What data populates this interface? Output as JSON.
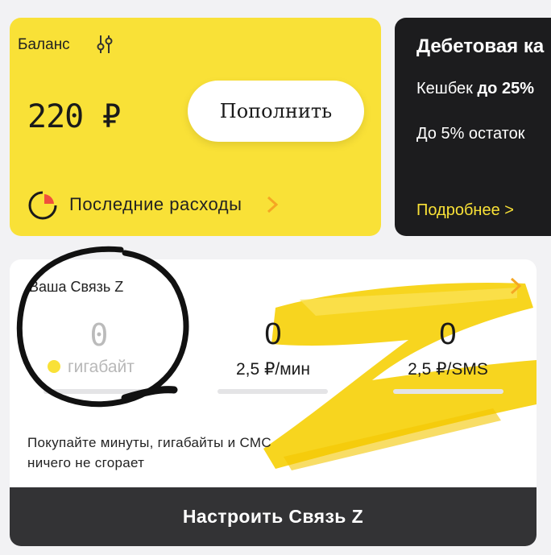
{
  "balance": {
    "title": "Баланс",
    "amount": "220 ₽",
    "topup_label": "Пополнить",
    "expenses_label": "Последние расходы"
  },
  "debit": {
    "title": "Дебетовая ка",
    "cashback_prefix": "Кешбек ",
    "cashback_bold": "до 25%",
    "balance_text": "До 5% остаток",
    "more_label": "Подробнее >"
  },
  "svyaz": {
    "title": "Ваша Связь Z",
    "stats": [
      {
        "value": "0",
        "unit": "гигабайт"
      },
      {
        "value": "0",
        "unit": "2,5 ₽/мин"
      },
      {
        "value": "0",
        "unit": "2,5 ₽/SMS"
      }
    ],
    "desc_line1": "Покупайте минуты, гигабайты и СМС",
    "desc_line2": "ничего не сгорает",
    "configure_label": "Настроить Связь Z"
  },
  "colors": {
    "accent_yellow": "#f9e137",
    "dark_card": "#1c1c1e",
    "button_dark": "#333335",
    "chevron_orange": "#f5a623",
    "expenses_red": "#f0503c"
  },
  "icons": [
    "settings-sliders-icon",
    "expenses-pie-icon",
    "chevron-right-icon",
    "data-coin-icon"
  ]
}
